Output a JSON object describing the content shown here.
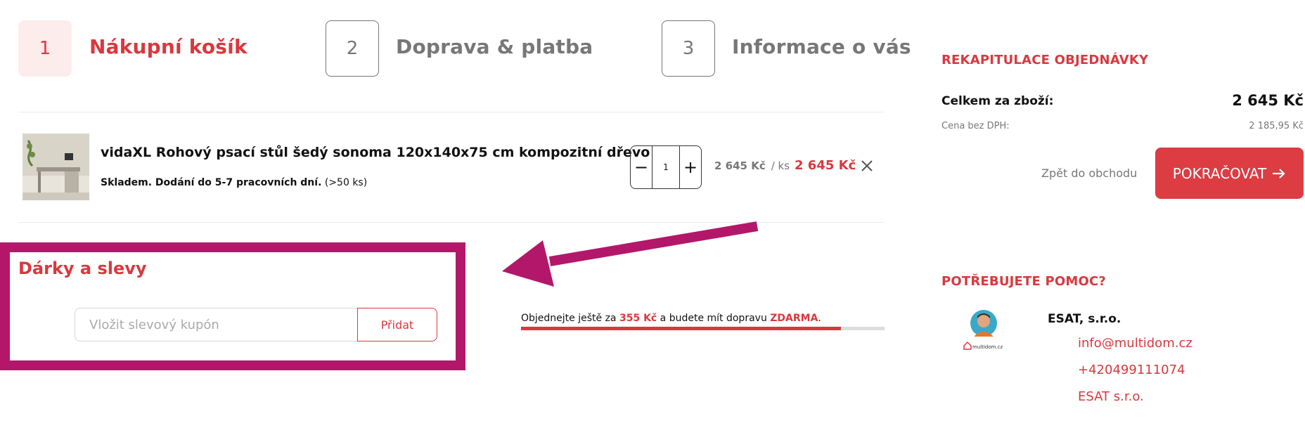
{
  "steps": [
    {
      "number": "1",
      "label": "Nákupní košík"
    },
    {
      "number": "2",
      "label": "Doprava & platba"
    },
    {
      "number": "3",
      "label": "Informace o vás"
    }
  ],
  "product": {
    "name": "vidaXL Rohový psací stůl šedý sonoma 120x140x75 cm kompozitní dřevo",
    "stock_status": "Skladem. Dodání do 5-7 pracovních dní.",
    "stock_count": "(>50 ks)",
    "quantity": "1",
    "unit_price": "2 645 Kč",
    "unit_suffix": "/ ks",
    "total_price": "2 645 Kč"
  },
  "gifts": {
    "title": "Dárky a slevy",
    "coupon_placeholder": "Vložit slevový kupón",
    "add_button": "Přidat"
  },
  "shipping": {
    "prefix": "Objednejte ještě za",
    "amount": "355 Kč",
    "middle": "a budete mít dopravu",
    "free_word": "ZDARMA",
    "suffix": ".",
    "progress": 0.88
  },
  "summary": {
    "title": "REKAPITULACE OBJEDNÁVKY",
    "total_label": "Celkem za zboží:",
    "total_value": "2 645 Kč",
    "vat_label": "Cena bez DPH:",
    "vat_value": "2 185,95 Kč",
    "back_link": "Zpět do obchodu",
    "continue_button": "POKRAČOVAT"
  },
  "help": {
    "title": "POTŘEBUJETE POMOC?",
    "avatar_logo": "multidom.cz",
    "company": "ESAT, s.r.o.",
    "email": "info@multidom.cz",
    "phone": "+420499111074",
    "company_link": "ESAT s.r.o."
  },
  "colors": {
    "accent": "#d9383f",
    "annotation": "#b3176a"
  }
}
